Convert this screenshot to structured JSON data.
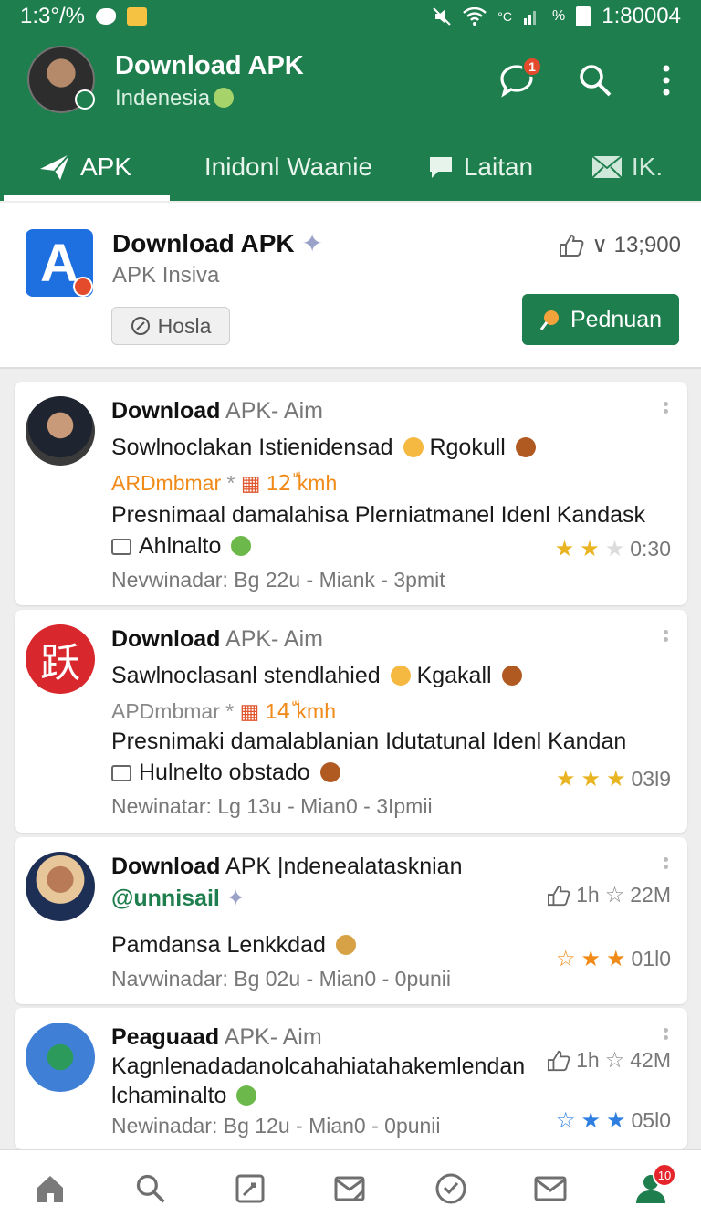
{
  "status_bar": {
    "left_time": "1:3°/%",
    "right_time": "1:80004",
    "net": "°C",
    "pct": "%"
  },
  "app_bar": {
    "title": "Download APK",
    "subtitle": "Indenesia",
    "chat_badge": "1",
    "accent": "#1f7e4d"
  },
  "tabs": [
    {
      "label": "APK",
      "icon": "send-icon"
    },
    {
      "label": "Inidonl Waanie",
      "icon": ""
    },
    {
      "label": "Laitan",
      "icon": "chat-bubble-icon"
    },
    {
      "label": "IK.",
      "icon": "mail-icon"
    }
  ],
  "featured": {
    "title": "Download APK",
    "subtitle": "APK Insiva",
    "chip": "Hosla",
    "stat": "∨ 13;900",
    "button": "Pednuan",
    "icon_letter": "A"
  },
  "posts": [
    {
      "name": "Download",
      "handle": "APK- Aim",
      "line1": "Sowlnoclakan Istienidensad",
      "line1_tail": "Rgokull",
      "meta_a": "ARDmbmar",
      "meta_sep": "*",
      "meta_b": "12ّ kmh",
      "line2": "Presnimaal damalahisa Plerniatmanel Idenl Kandask",
      "line3": "Ahlnalto",
      "rating_time": "0:30",
      "footer": "Nevwinadar: Bg 22u - Miank - 3pmit"
    },
    {
      "name": "Download",
      "handle": "APK- Aim",
      "line1": "Sawlnoclasanl stendlahied",
      "line1_tail": "Kgakall",
      "meta_a": "APDmbmar",
      "meta_sep": "*",
      "meta_b": "14ّ kmh",
      "line2": "Presnimaki damalablanian Idutatunal Idenl Kandan",
      "line3": "Hulnelto obstado",
      "rating_time": "03l9",
      "footer": "Newinatar: Lg 13u - Mian0 - 3Ipmii",
      "avatar_char": "跃"
    },
    {
      "name": "Download",
      "handle": "APK |ndenealatasknian",
      "line1": "@unnisail",
      "stat_a": "1h",
      "stat_b": "22M",
      "line2": "Pamdansa Lenkkdad",
      "rating_time": "01l0",
      "footer": "Navwinadar: Bg 02u - Mian0 - 0punii"
    },
    {
      "name": "Peaguaad",
      "handle": "APK- Aim",
      "line1": "Kagnlenadadanolcahahiatahakemlendan",
      "line2": "lchaminalto",
      "stat_a": "1h",
      "stat_b": "42M",
      "rating_time": "05l0",
      "footer": "Newinadar: Bg 12u - Mian0 - 0punii"
    }
  ],
  "bottom_nav": {
    "items": [
      "home-icon",
      "search-icon",
      "edit-icon",
      "mail-edit-icon",
      "check-circle-icon",
      "mail-icon",
      "profile-icon"
    ],
    "profile_badge": "10"
  }
}
